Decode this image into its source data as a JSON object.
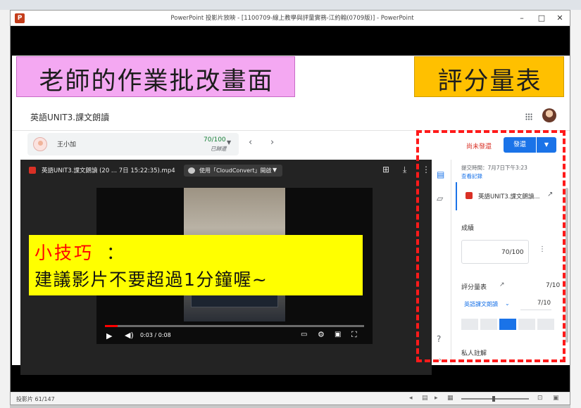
{
  "window": {
    "title": "PowerPoint 投影片放映 - [1100709-線上教學與評量實務-江約翰(0709版)] - PowerPoint",
    "app_icon_letter": "P",
    "minimize": "–",
    "maximize": "□",
    "close": "✕"
  },
  "slide_labels": {
    "left": "老師的作業批改畫面",
    "right": "評分量表"
  },
  "classroom": {
    "course_title": "英語UNIT3.課文朗讀",
    "student": {
      "name": "王小加",
      "score": "70/100",
      "status": "已歸還"
    },
    "not_submitted": "尚未發還",
    "return_button": "發還"
  },
  "video": {
    "file_name": "英語UNIT3.課文朗讀 (20 ... 7日 15:22:35).mp4",
    "open_with": "使用「CloudConvert」開啟",
    "time": "0:03 / 0:08",
    "progress": 0.05
  },
  "tip": {
    "title": "小技巧",
    "colon": "：",
    "body": "建議影片不要超過1分鐘喔~"
  },
  "panel": {
    "submission_time": "提交時間：7月7日下午3:23",
    "history": "查看記錄",
    "attachment": "英語UNIT3.課文朗讀...",
    "grade_label": "成績",
    "grade_value": "70/100",
    "rubric_label": "評分量表",
    "rubric_score": "7/10",
    "criterion_name": "英語課文朗讀",
    "criterion_score": "7/10",
    "selected_level": 3,
    "private_comment": "私人註解"
  },
  "statusbar": {
    "slide_count": "投影片 61/147"
  },
  "colors": {
    "left_label_bg": "#f4a8f2",
    "right_label_bg": "#ffc000",
    "tip_bg": "#ffff00",
    "tip_title": "#ff0000",
    "accent": "#1a73e8",
    "red_frame": "#ff1a1a"
  }
}
